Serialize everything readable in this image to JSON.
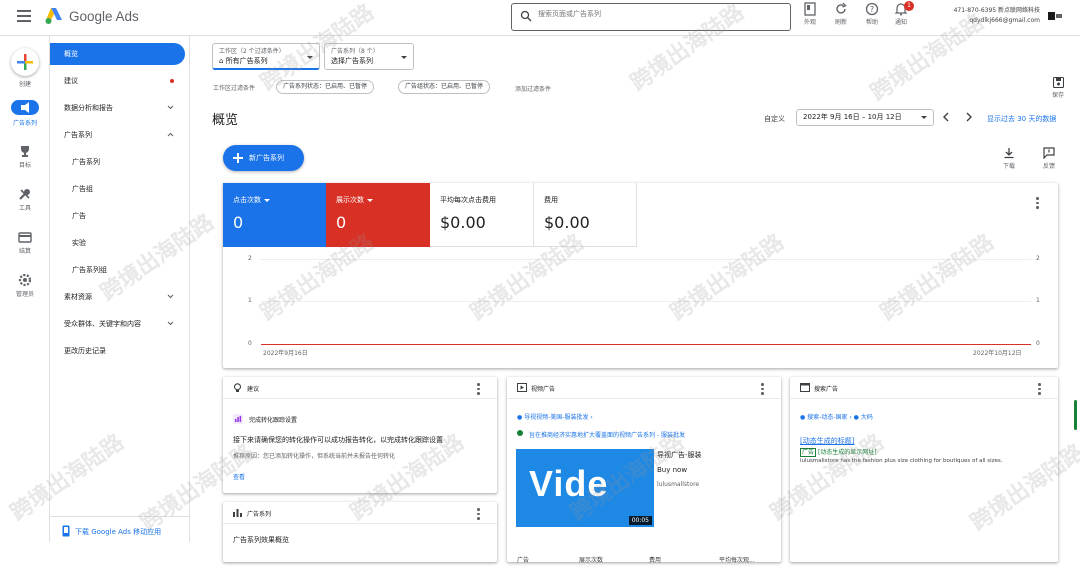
{
  "header": {
    "app_name": "Google Ads",
    "search_placeholder": "搜索页面或广告系列",
    "tools": [
      {
        "label": "外观",
        "icon": "appearance-icon"
      },
      {
        "label": "刷新",
        "icon": "refresh-icon"
      },
      {
        "label": "帮助",
        "icon": "help-icon"
      },
      {
        "label": "通知",
        "icon": "bell-icon",
        "badge": "1"
      }
    ],
    "account_id": "471-870-6395 新点联网络科技",
    "account_email": "qdydlkj666@gmail.com"
  },
  "rail": {
    "items": [
      {
        "label": "创建",
        "icon": "create-plus-icon"
      },
      {
        "label": "广告系列",
        "icon": "campaigns-megaphone-icon"
      },
      {
        "label": "目标",
        "icon": "goals-trophy-icon"
      },
      {
        "label": "工具",
        "icon": "tools-wrench-icon"
      },
      {
        "label": "结算",
        "icon": "billing-card-icon"
      },
      {
        "label": "管理员",
        "icon": "admin-gear-icon"
      }
    ]
  },
  "nav": {
    "items": [
      {
        "label": "概览",
        "active": true
      },
      {
        "label": "建议",
        "dot": true
      },
      {
        "label": "数据分析和报告",
        "chevron": "down"
      },
      {
        "label": "广告系列",
        "chevron": "up"
      },
      {
        "label": "广告系列",
        "sub": true
      },
      {
        "label": "广告组",
        "sub": true
      },
      {
        "label": "广告",
        "sub": true
      },
      {
        "label": "实验",
        "sub": true
      },
      {
        "label": "广告系列组",
        "sub": true
      },
      {
        "label": "素材资源",
        "chevron": "down"
      },
      {
        "label": "受众群体、关键字和内容",
        "chevron": "down"
      },
      {
        "label": "更改历史记录"
      }
    ],
    "footer_link": "下载 Google Ads 移动应用"
  },
  "filters": {
    "workspace_label": "工作区（2 个过滤条件）",
    "workspace_value": "所有广告系列",
    "campaign_label": "广告系列（8 个）",
    "campaign_value": "选择广告系列",
    "ws_filter_label": "工作区过滤条件",
    "chips": [
      "广告系列状态：已启用、已暂停",
      "广告组状态：已启用、已暂停"
    ],
    "add_filter": "添加过滤条件",
    "save_label": "保存"
  },
  "page": {
    "title": "概览",
    "date_custom": "自定义",
    "date_range": "2022年 9月 16日 – 10月 12日",
    "show_last": "显示过去 30 天的数据",
    "new_campaign": "新广告系列",
    "download": "下载",
    "feedback": "反馈"
  },
  "metrics": [
    {
      "label": "点击次数",
      "value": "0",
      "color": "#1a73e8",
      "dropdown": true
    },
    {
      "label": "展示次数",
      "value": "0",
      "color": "#d93025",
      "dropdown": true
    },
    {
      "label": "平均每次点击费用",
      "value": "$0.00",
      "color": "#ffffff",
      "dropdown": false
    },
    {
      "label": "费用",
      "value": "$0.00",
      "color": "#ffffff",
      "dropdown": false
    }
  ],
  "chart_data": {
    "type": "line",
    "x": [
      "2022年9月16日",
      "2022年10月12日"
    ],
    "series": [
      {
        "values": [
          0,
          0
        ],
        "color": "#d93025"
      }
    ],
    "yticks_left": [
      "2",
      "1",
      "0"
    ],
    "yticks_right": [
      "2",
      "1",
      "0"
    ],
    "ylim": [
      0,
      2
    ],
    "grid": true
  },
  "cards": {
    "suggestions": {
      "title": "建议",
      "item_title": "完成转化跟踪设置",
      "body": "接下来请确保您的转化操作可以成功报告转化，以完成转化跟踪设置",
      "reason": "推荐原因：您已添加转化操作，但系统当前并未报告任何转化",
      "link": "查看"
    },
    "video": {
      "title": "视频广告",
      "breadcrumb": "● 导视视频-美国-服装批发 ›",
      "campaign": "旨在推商经济实惠地扩大覆盖面的视频广告系列 - 服装批发",
      "ad_title": "导视广告-服装",
      "cta": "Buy now",
      "domain": "lulusmallstore",
      "thumb_text": "Vide",
      "duration": "00:05",
      "cols": [
        "广告",
        "展示次数",
        "费用",
        "平均每次观..."
      ]
    },
    "search": {
      "title": "搜索广告",
      "breadcrumb": "● 搜索-动态-国家 › ● 大码",
      "headline": "[动态生成的标题]",
      "ad_label": "广告",
      "display_url": "[动态生成的显示网址]",
      "desc": "lulusmallstore has the fashion plus size clothing for boutiques of all sizes."
    },
    "campaigns": {
      "title": "广告系列",
      "sub": "广告系列效果概览"
    }
  },
  "watermark_text": "跨境出海陆路"
}
